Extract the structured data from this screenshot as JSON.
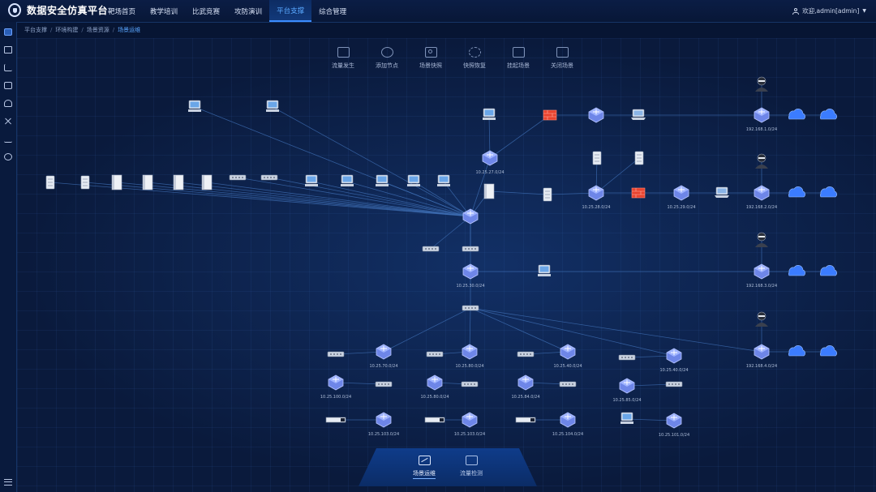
{
  "app": {
    "title": "数据安全仿真平台"
  },
  "nav": {
    "items": [
      {
        "label": "靶场首页"
      },
      {
        "label": "教学培训"
      },
      {
        "label": "比武竞赛"
      },
      {
        "label": "攻防演训"
      },
      {
        "label": "平台支撑",
        "active": true
      },
      {
        "label": "综合管理"
      }
    ]
  },
  "user": {
    "greeting": "欢迎,admin[admin]"
  },
  "sidebar": {
    "icons": [
      "database-icon",
      "list-icon",
      "chart-icon",
      "document-icon",
      "storage-icon",
      "tools-icon",
      "analytics-icon",
      "settings-icon"
    ]
  },
  "breadcrumb": {
    "items": [
      "平台支撑",
      "环境构建",
      "场景资源",
      "场景运维"
    ]
  },
  "toolbar": {
    "items": [
      {
        "label": "流量发生",
        "icon": "traffic-icon"
      },
      {
        "label": "添加节点",
        "icon": "add-node-icon"
      },
      {
        "label": "场景快照",
        "icon": "snapshot-icon"
      },
      {
        "label": "快照恢复",
        "icon": "restore-icon"
      },
      {
        "label": "挂起场景",
        "icon": "suspend-icon"
      },
      {
        "label": "关闭场景",
        "icon": "close-scene-icon"
      }
    ]
  },
  "topology": {
    "nodes": [
      {
        "id": "pc-a",
        "type": "pc"
      },
      {
        "id": "pc-b",
        "type": "pc"
      },
      {
        "id": "n1",
        "type": "server"
      },
      {
        "id": "n2",
        "type": "server"
      },
      {
        "id": "n3",
        "type": "tower"
      },
      {
        "id": "n4",
        "type": "tower"
      },
      {
        "id": "n5",
        "type": "tower"
      },
      {
        "id": "n6",
        "type": "tower"
      },
      {
        "id": "n7",
        "type": "sw"
      },
      {
        "id": "n8",
        "type": "sw"
      },
      {
        "id": "n9",
        "type": "pc"
      },
      {
        "id": "n10",
        "type": "pc"
      },
      {
        "id": "n11",
        "type": "pc"
      },
      {
        "id": "n12",
        "type": "pc"
      },
      {
        "id": "n13",
        "type": "pc"
      },
      {
        "id": "core",
        "type": "router"
      },
      {
        "id": "rt-up",
        "type": "router",
        "ip": "10.25.27.0/24"
      },
      {
        "id": "pc-up",
        "type": "pc"
      },
      {
        "id": "fw-up",
        "type": "fw"
      },
      {
        "id": "rt-top",
        "type": "router"
      },
      {
        "id": "lap-top",
        "type": "laptop"
      },
      {
        "id": "hacker1",
        "type": "hacker"
      },
      {
        "id": "rt-r1",
        "type": "router",
        "ip": "192.168.1.0/24"
      },
      {
        "id": "cl1",
        "type": "cloud"
      },
      {
        "id": "cd1",
        "type": "cloud"
      },
      {
        "id": "srv-a",
        "type": "server"
      },
      {
        "id": "srv-b",
        "type": "server"
      },
      {
        "id": "big-srv",
        "type": "tower"
      },
      {
        "id": "srv-c",
        "type": "server"
      },
      {
        "id": "rt-mid",
        "type": "router",
        "ip": "10.25.28.0/24"
      },
      {
        "id": "fw-mid",
        "type": "fw"
      },
      {
        "id": "rt-mid2",
        "type": "router",
        "ip": "10.25.29.0/24"
      },
      {
        "id": "lap-mid",
        "type": "laptop"
      },
      {
        "id": "hacker2",
        "type": "hacker"
      },
      {
        "id": "rt-r2",
        "type": "router",
        "ip": "192.168.2.0/24"
      },
      {
        "id": "cl2",
        "type": "cloud"
      },
      {
        "id": "cd2",
        "type": "cloud"
      },
      {
        "id": "sw-a",
        "type": "sw"
      },
      {
        "id": "sw-b",
        "type": "sw"
      },
      {
        "id": "rt-c",
        "type": "router",
        "ip": "10.25.30.0/24"
      },
      {
        "id": "pc-route",
        "type": "pc"
      },
      {
        "id": "hacker3",
        "type": "hacker"
      },
      {
        "id": "rt-r3",
        "type": "router",
        "ip": "192.168.3.0/24"
      },
      {
        "id": "cl3",
        "type": "cloud"
      },
      {
        "id": "cd3",
        "type": "cloud"
      },
      {
        "id": "agg",
        "type": "sw"
      },
      {
        "id": "hacker4",
        "type": "hacker"
      },
      {
        "id": "rt-r4",
        "type": "router",
        "ip": "192.168.4.0/24"
      },
      {
        "id": "cl4",
        "type": "cloud"
      },
      {
        "id": "cd4",
        "type": "cloud"
      },
      {
        "id": "b1-sw",
        "type": "sw"
      },
      {
        "id": "b1-rt",
        "type": "router",
        "ip": "10.25.70.0/24"
      },
      {
        "id": "b1-rt2",
        "type": "router",
        "ip": "10.25.100.0/24"
      },
      {
        "id": "b1-sw2",
        "type": "sw"
      },
      {
        "id": "b1-rack",
        "type": "rack"
      },
      {
        "id": "b1-rt3",
        "type": "router",
        "ip": "10.25.103.0/24"
      },
      {
        "id": "b2-sw",
        "type": "sw"
      },
      {
        "id": "b2-rt",
        "type": "router",
        "ip": "10.25.80.0/24"
      },
      {
        "id": "b2-rt2",
        "type": "router",
        "ip": "10.25.80.0/24"
      },
      {
        "id": "b2-sw2",
        "type": "sw"
      },
      {
        "id": "b2-rack",
        "type": "rack"
      },
      {
        "id": "b2-rt3",
        "type": "router",
        "ip": "10.25.103.0/24"
      },
      {
        "id": "b3-sw",
        "type": "sw"
      },
      {
        "id": "b3-rt",
        "type": "router",
        "ip": "10.25.40.0/24"
      },
      {
        "id": "b3-rt2",
        "type": "router",
        "ip": "10.25.84.0/24"
      },
      {
        "id": "b3-sw2",
        "type": "sw"
      },
      {
        "id": "b3-rack",
        "type": "rack"
      },
      {
        "id": "b3-rt3",
        "type": "router",
        "ip": "10.25.104.0/24"
      },
      {
        "id": "b4-sw",
        "type": "sw"
      },
      {
        "id": "b4-rt",
        "type": "router",
        "ip": "10.25.40.0/24"
      },
      {
        "id": "b4-rt2",
        "type": "router",
        "ip": "10.25.85.0/24"
      },
      {
        "id": "b4-sw2",
        "type": "sw"
      },
      {
        "id": "b4-pc",
        "type": "pc"
      },
      {
        "id": "b4-rt3",
        "type": "router",
        "ip": "10.25.101.0/24"
      }
    ],
    "links": [
      [
        "core",
        "pc-a"
      ],
      [
        "core",
        "pc-b"
      ],
      [
        "core",
        "n1"
      ],
      [
        "core",
        "n2"
      ],
      [
        "core",
        "n3"
      ],
      [
        "core",
        "n4"
      ],
      [
        "core",
        "n5"
      ],
      [
        "core",
        "n6"
      ],
      [
        "core",
        "n7"
      ],
      [
        "core",
        "n8"
      ],
      [
        "core",
        "n9"
      ],
      [
        "core",
        "n10"
      ],
      [
        "core",
        "n11"
      ],
      [
        "core",
        "n12"
      ],
      [
        "core",
        "n13"
      ],
      [
        "core",
        "rt-up"
      ],
      [
        "rt-up",
        "pc-up"
      ],
      [
        "rt-up",
        "fw-up"
      ],
      [
        "fw-up",
        "rt-top"
      ],
      [
        "rt-top",
        "lap-top"
      ],
      [
        "lap-top",
        "rt-r1"
      ],
      [
        "rt-r1",
        "cl1"
      ],
      [
        "cl1",
        "cd1"
      ],
      [
        "hacker1",
        "rt-r1"
      ],
      [
        "core",
        "big-srv"
      ],
      [
        "big-srv",
        "srv-c"
      ],
      [
        "srv-c",
        "rt-mid"
      ],
      [
        "rt-mid",
        "srv-a"
      ],
      [
        "rt-mid",
        "srv-b"
      ],
      [
        "rt-mid",
        "fw-mid"
      ],
      [
        "fw-mid",
        "rt-mid2"
      ],
      [
        "rt-mid2",
        "lap-mid"
      ],
      [
        "lap-mid",
        "rt-r2"
      ],
      [
        "rt-r2",
        "cl2"
      ],
      [
        "cl2",
        "cd2"
      ],
      [
        "hacker2",
        "rt-r2"
      ],
      [
        "core",
        "sw-a"
      ],
      [
        "core",
        "sw-b"
      ],
      [
        "core",
        "rt-c"
      ],
      [
        "rt-c",
        "pc-route"
      ],
      [
        "pc-route",
        "rt-r3"
      ],
      [
        "rt-r3",
        "cl3"
      ],
      [
        "cl3",
        "cd3"
      ],
      [
        "hacker3",
        "rt-r3"
      ],
      [
        "rt-c",
        "agg"
      ],
      [
        "agg",
        "b1-rt"
      ],
      [
        "agg",
        "b2-rt"
      ],
      [
        "agg",
        "b3-rt"
      ],
      [
        "agg",
        "b4-rt"
      ],
      [
        "agg",
        "rt-r4"
      ],
      [
        "rt-r4",
        "cl4"
      ],
      [
        "cl4",
        "cd4"
      ],
      [
        "hacker4",
        "rt-r4"
      ],
      [
        "b1-sw",
        "b1-rt"
      ],
      [
        "b1-rt2",
        "b1-sw2"
      ],
      [
        "b1-rack",
        "b1-rt3"
      ],
      [
        "b2-sw",
        "b2-rt"
      ],
      [
        "b2-rt2",
        "b2-sw2"
      ],
      [
        "b2-rack",
        "b2-rt3"
      ],
      [
        "b3-sw",
        "b3-rt"
      ],
      [
        "b3-rt2",
        "b3-sw2"
      ],
      [
        "b3-rack",
        "b3-rt3"
      ],
      [
        "b4-sw",
        "b4-rt"
      ],
      [
        "b4-rt2",
        "b4-sw2"
      ],
      [
        "b4-pc",
        "b4-rt3"
      ]
    ]
  },
  "bottom_panel": {
    "items": [
      {
        "label": "场景运维",
        "active": true
      },
      {
        "label": "流量检测",
        "active": false
      }
    ]
  },
  "colors": {
    "accent": "#3b8cff",
    "router": "#6e86e8",
    "firewall": "#e8432f",
    "cloud": "#3b7cff"
  }
}
